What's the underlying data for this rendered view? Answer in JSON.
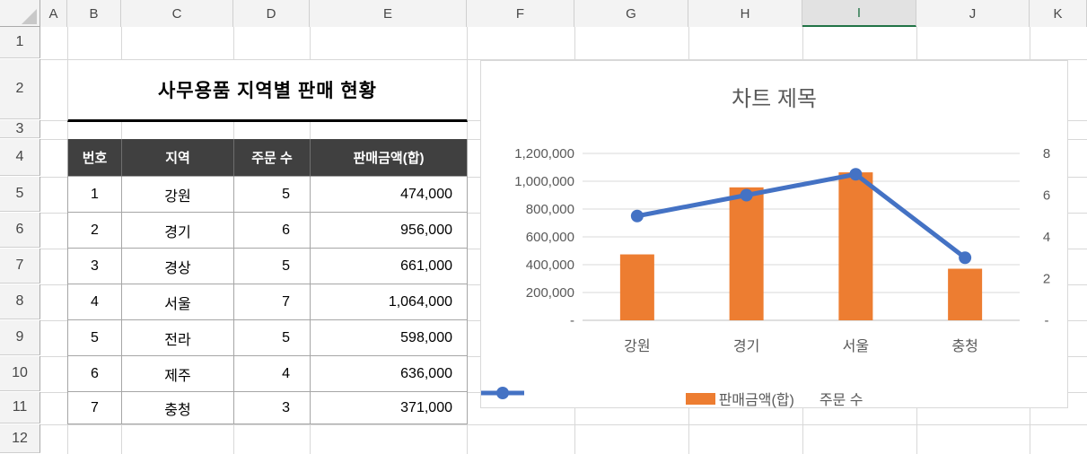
{
  "sheet": {
    "column_headers": [
      "A",
      "B",
      "C",
      "D",
      "E",
      "F",
      "G",
      "H",
      "I",
      "J",
      "K"
    ],
    "selected_column": "I",
    "row_headers": [
      "1",
      "2",
      "3",
      "4",
      "5",
      "6",
      "7",
      "8",
      "9",
      "10",
      "11",
      "12"
    ]
  },
  "table": {
    "title": "사무용품 지역별 판매 현황",
    "columns": [
      "번호",
      "지역",
      "주문 수",
      "판매금액(합)"
    ],
    "rows": [
      [
        "1",
        "강원",
        "5",
        "474,000"
      ],
      [
        "2",
        "경기",
        "6",
        "956,000"
      ],
      [
        "3",
        "경상",
        "5",
        "661,000"
      ],
      [
        "4",
        "서울",
        "7",
        "1,064,000"
      ],
      [
        "5",
        "전라",
        "5",
        "598,000"
      ],
      [
        "6",
        "제주",
        "4",
        "636,000"
      ],
      [
        "7",
        "충청",
        "3",
        "371,000"
      ]
    ]
  },
  "chart_data": {
    "type": "bar",
    "subtype": "combo-bar-line-dual-axis",
    "title": "차트 제목",
    "categories": [
      "강원",
      "경기",
      "서울",
      "충청"
    ],
    "series": [
      {
        "name": "판매금액(합)",
        "type": "bar",
        "axis": "left",
        "values": [
          474000,
          956000,
          1064000,
          371000
        ],
        "color": "#ED7D31"
      },
      {
        "name": "주문 수",
        "type": "line",
        "axis": "right",
        "values": [
          5,
          6,
          7,
          3
        ],
        "color": "#4472C4"
      }
    ],
    "left_axis": {
      "min": 0,
      "max": 1200000,
      "tick_step": 200000,
      "tick_labels": [
        "1,200,000",
        "1,000,000",
        "800,000",
        "600,000",
        "400,000",
        "200,000",
        "-"
      ]
    },
    "right_axis": {
      "min": 0,
      "max": 8,
      "tick_step": 2,
      "tick_labels": [
        "8",
        "6",
        "4",
        "2",
        "-"
      ]
    },
    "grid": true,
    "legend_position": "bottom"
  },
  "colors": {
    "bar": "#ED7D31",
    "line": "#4472C4",
    "chart_text": "#595959",
    "chart_gridline": "#d9d9d9",
    "chart_axis_line": "#bfbfbf",
    "table_header_bg": "#404040",
    "table_header_text": "#ffffff",
    "table_border": "#a6a6a6",
    "selection_green": "#217346",
    "sheet_gridline": "#d8d8d8",
    "header_bg": "#f3f3f3",
    "header_text": "#474747"
  }
}
